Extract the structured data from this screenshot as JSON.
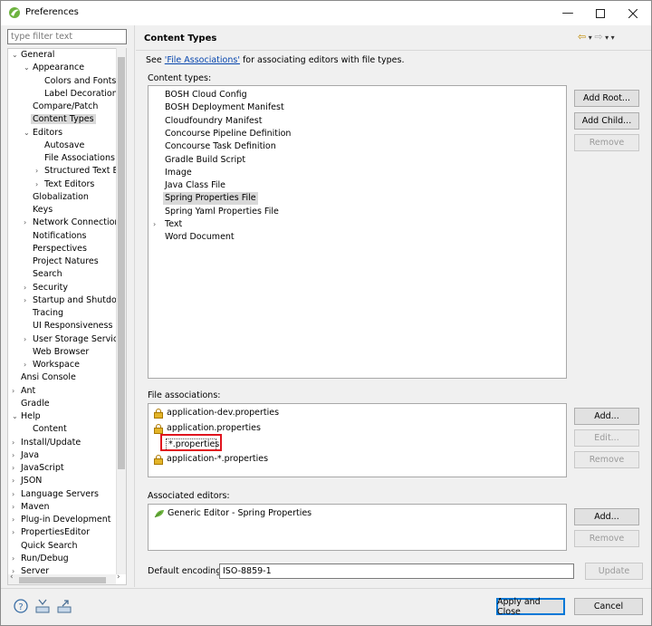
{
  "window": {
    "title": "Preferences"
  },
  "sidebar": {
    "filter_placeholder": "type filter text",
    "items": [
      {
        "label": "General",
        "chev": "⌄",
        "level": 0
      },
      {
        "label": "Appearance",
        "chev": "⌄",
        "level": 1
      },
      {
        "label": "Colors and Fonts",
        "chev": "",
        "level": 2
      },
      {
        "label": "Label Decorations",
        "chev": "",
        "level": 2
      },
      {
        "label": "Compare/Patch",
        "chev": "",
        "level": 1
      },
      {
        "label": "Content Types",
        "chev": "",
        "level": 1,
        "selected": true
      },
      {
        "label": "Editors",
        "chev": "⌄",
        "level": 1
      },
      {
        "label": "Autosave",
        "chev": "",
        "level": 2
      },
      {
        "label": "File Associations",
        "chev": "",
        "level": 2
      },
      {
        "label": "Structured Text Ec",
        "chev": "›",
        "level": 2
      },
      {
        "label": "Text Editors",
        "chev": "›",
        "level": 2
      },
      {
        "label": "Globalization",
        "chev": "",
        "level": 1
      },
      {
        "label": "Keys",
        "chev": "",
        "level": 1
      },
      {
        "label": "Network Connection",
        "chev": "›",
        "level": 1
      },
      {
        "label": "Notifications",
        "chev": "",
        "level": 1
      },
      {
        "label": "Perspectives",
        "chev": "",
        "level": 1
      },
      {
        "label": "Project Natures",
        "chev": "",
        "level": 1
      },
      {
        "label": "Search",
        "chev": "",
        "level": 1
      },
      {
        "label": "Security",
        "chev": "›",
        "level": 1
      },
      {
        "label": "Startup and Shutdov",
        "chev": "›",
        "level": 1
      },
      {
        "label": "Tracing",
        "chev": "",
        "level": 1
      },
      {
        "label": "UI Responsiveness M",
        "chev": "",
        "level": 1
      },
      {
        "label": "User Storage Service",
        "chev": "›",
        "level": 1
      },
      {
        "label": "Web Browser",
        "chev": "",
        "level": 1
      },
      {
        "label": "Workspace",
        "chev": "›",
        "level": 1
      },
      {
        "label": "Ansi Console",
        "chev": "",
        "level": 0
      },
      {
        "label": "Ant",
        "chev": "›",
        "level": 0
      },
      {
        "label": "Gradle",
        "chev": "",
        "level": 0
      },
      {
        "label": "Help",
        "chev": "⌄",
        "level": 0
      },
      {
        "label": "Content",
        "chev": "",
        "level": 1
      },
      {
        "label": "Install/Update",
        "chev": "›",
        "level": 0
      },
      {
        "label": "Java",
        "chev": "›",
        "level": 0
      },
      {
        "label": "JavaScript",
        "chev": "›",
        "level": 0
      },
      {
        "label": "JSON",
        "chev": "›",
        "level": 0
      },
      {
        "label": "Language Servers",
        "chev": "›",
        "level": 0
      },
      {
        "label": "Maven",
        "chev": "›",
        "level": 0
      },
      {
        "label": "Plug-in Development",
        "chev": "›",
        "level": 0
      },
      {
        "label": "PropertiesEditor",
        "chev": "›",
        "level": 0
      },
      {
        "label": "Quick Search",
        "chev": "",
        "level": 0
      },
      {
        "label": "Run/Debug",
        "chev": "›",
        "level": 0
      },
      {
        "label": "Server",
        "chev": "›",
        "level": 0
      }
    ]
  },
  "main": {
    "title": "Content Types",
    "see_prefix": "See ",
    "see_link": "'File Associations'",
    "see_suffix": " for associating editors with file types.",
    "content_types_label": "Content types:",
    "content_types": [
      {
        "label": "BOSH Cloud Config"
      },
      {
        "label": "BOSH Deployment Manifest"
      },
      {
        "label": "Cloudfoundry Manifest"
      },
      {
        "label": "Concourse Pipeline Definition"
      },
      {
        "label": "Concourse Task Definition"
      },
      {
        "label": "Gradle Build Script"
      },
      {
        "label": "Image"
      },
      {
        "label": "Java Class File"
      },
      {
        "label": "Spring Properties File",
        "selected": true
      },
      {
        "label": "Spring Yaml Properties File"
      },
      {
        "label": "Text",
        "expandable": true
      },
      {
        "label": "Word Document"
      }
    ],
    "add_root": "Add Root...",
    "add_child": "Add Child...",
    "remove_ct": "Remove",
    "file_assoc_label": "File associations:",
    "file_assocs": [
      {
        "label": "application-dev.properties",
        "locked": true
      },
      {
        "label": "application.properties",
        "locked": true
      },
      {
        "label": "*.properties",
        "locked": false,
        "editing": true
      },
      {
        "label": "application-*.properties",
        "locked": true
      }
    ],
    "fa_add": "Add...",
    "fa_edit": "Edit...",
    "fa_remove": "Remove",
    "assoc_editors_label": "Associated editors:",
    "assoc_editors": [
      {
        "label": "Generic Editor - Spring Properties"
      }
    ],
    "ed_add": "Add...",
    "ed_remove": "Remove",
    "encoding_label": "Default encoding:",
    "encoding_value": "ISO-8859-1",
    "update": "Update"
  },
  "footer": {
    "apply_close": "Apply and Close",
    "cancel": "Cancel"
  },
  "colors": {
    "accent": "#0078d7",
    "highlight": "#e0141e",
    "link": "#0645ad"
  }
}
